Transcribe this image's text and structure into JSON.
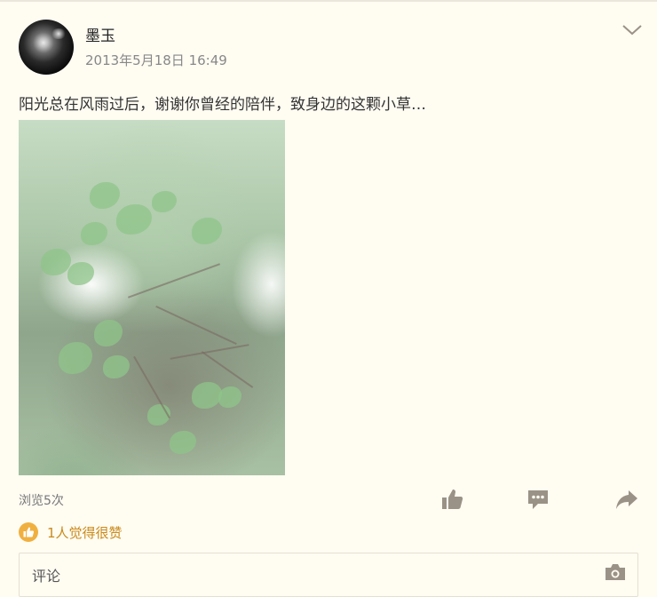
{
  "post": {
    "author": "墨玉",
    "timestamp": "2013年5月18日 16:49",
    "text": "阳光总在风雨过后，谢谢你曾经的陪伴，致身边的这颗小草…",
    "views": "浏览5次",
    "likes_text": "1人觉得很赞"
  },
  "comment": {
    "placeholder": "评论"
  },
  "icons": {
    "more": "chevron-down-icon",
    "like": "thumbs-up-icon",
    "comment": "speech-bubble-icon",
    "share": "share-arrow-icon",
    "camera": "camera-icon"
  },
  "colors": {
    "background": "#fffcf2",
    "icon_gray": "#9a9286",
    "like_gold": "#f0b040",
    "like_text": "#c98a1a"
  }
}
